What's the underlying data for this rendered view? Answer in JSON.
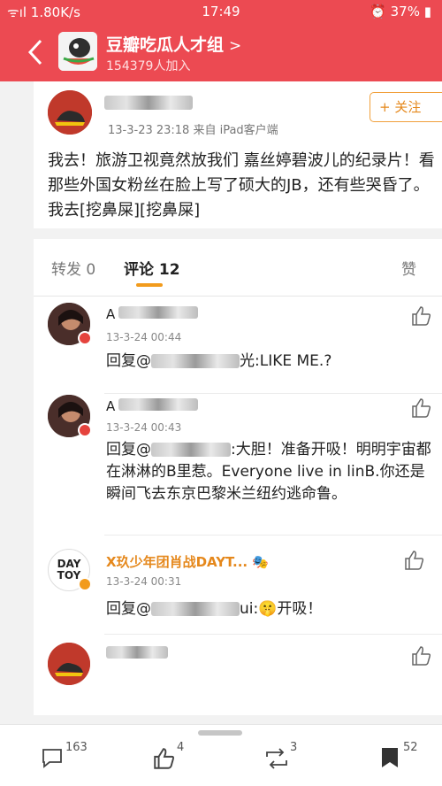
{
  "status_bar": {
    "signal": "ᯤıl 1.80K/s",
    "time": "17:49",
    "battery": "37%"
  },
  "header": {
    "group_name": "豆瓣吃瓜人才组",
    "chevron": ">",
    "members": "154379人加入"
  },
  "post": {
    "meta": "13-3-23 23:18  来自 iPad客户端",
    "follow_label": "+ 关注",
    "text": "我去！旅游卫视竟然放我们 嘉丝婷碧波儿的纪录片！看那些外国女粉丝在脸上写了硕大的JB，还有些哭昏了。我去[挖鼻屎][挖鼻屎]"
  },
  "tabs": {
    "repost": "转发 0",
    "comments": "评论 12",
    "likes": "赞"
  },
  "comments": [
    {
      "name": "A",
      "time": "13-3-24 00:44",
      "reply_prefix": "回复@",
      "reply_tail": "光:LIKE ME.?"
    },
    {
      "name": "A",
      "time": "13-3-24 00:43",
      "reply_prefix": "回复@",
      "reply_tail": ":大胆！准备开吸！明明宇宙都在淋淋的B里惹。Everyone live in linB.你还是瞬间飞去东京巴黎米兰纽约逃命鲁。"
    },
    {
      "name": "X玖少年团肖战DAYT...",
      "time": "13-3-24 00:31",
      "reply_prefix": "回复@",
      "reply_tail": "ui:🤫开吸！",
      "avatar_text": "DAY TOY"
    },
    {
      "name": "",
      "time": ""
    }
  ],
  "bottom_bar": {
    "comment_count": "163",
    "like_count": "4",
    "repost_count": "3",
    "collect_count": "52"
  },
  "colors": {
    "brand_red": "#ec4a52",
    "accent_orange": "#f29b1c"
  },
  "icons": [
    "back-arrow-icon",
    "comment-icon",
    "thumb-up-icon",
    "repost-icon",
    "bookmark-icon",
    "alarm-icon",
    "battery-icon"
  ]
}
